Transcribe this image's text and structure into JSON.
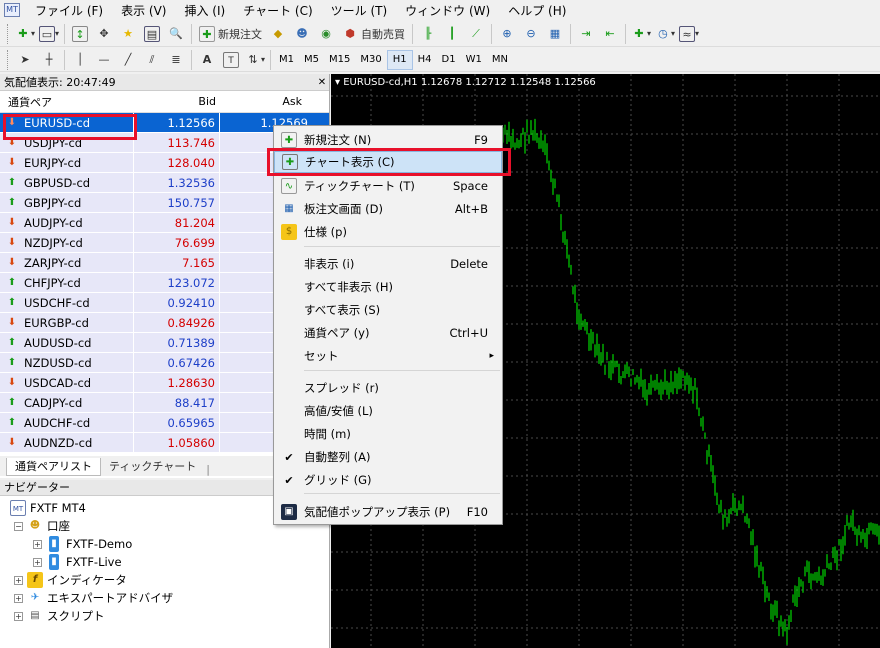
{
  "menubar": {
    "items": [
      "ファイル (F)",
      "表示 (V)",
      "挿入 (I)",
      "チャート (C)",
      "ツール (T)",
      "ウィンドウ (W)",
      "ヘルプ (H)"
    ]
  },
  "toolbar": {
    "new_order_label": "新規注文",
    "auto_trading_label": "自動売買",
    "timeframes": [
      "M1",
      "M5",
      "M15",
      "M30",
      "H1",
      "H4",
      "D1",
      "W1",
      "MN"
    ],
    "active_timeframe": "H1"
  },
  "market_watch": {
    "title": "気配値表示: 20:47:49",
    "columns": [
      "通貨ペア",
      "Bid",
      "Ask"
    ],
    "rows": [
      {
        "symbol": "EURUSD-cd",
        "bid": "1.12566",
        "ask": "1.12569",
        "dir": "dn",
        "selected": true
      },
      {
        "symbol": "USDJPY-cd",
        "bid": "113.746",
        "ask": "11",
        "dir": "dn"
      },
      {
        "symbol": "EURJPY-cd",
        "bid": "128.040",
        "ask": "12",
        "dir": "dn"
      },
      {
        "symbol": "GBPUSD-cd",
        "bid": "1.32536",
        "ask": "1.",
        "dir": "up"
      },
      {
        "symbol": "GBPJPY-cd",
        "bid": "150.757",
        "ask": "15",
        "dir": "up"
      },
      {
        "symbol": "AUDJPY-cd",
        "bid": "81.204",
        "ask": "8",
        "dir": "dn"
      },
      {
        "symbol": "NZDJPY-cd",
        "bid": "76.699",
        "ask": "7",
        "dir": "dn"
      },
      {
        "symbol": "ZARJPY-cd",
        "bid": "7.165",
        "ask": "",
        "dir": "dn"
      },
      {
        "symbol": "CHFJPY-cd",
        "bid": "123.072",
        "ask": "12",
        "dir": "up"
      },
      {
        "symbol": "USDCHF-cd",
        "bid": "0.92410",
        "ask": "0.",
        "dir": "up"
      },
      {
        "symbol": "EURGBP-cd",
        "bid": "0.84926",
        "ask": "0.",
        "dir": "dn"
      },
      {
        "symbol": "AUDUSD-cd",
        "bid": "0.71389",
        "ask": "0.",
        "dir": "up"
      },
      {
        "symbol": "NZDUSD-cd",
        "bid": "0.67426",
        "ask": "0.",
        "dir": "up"
      },
      {
        "symbol": "USDCAD-cd",
        "bid": "1.28630",
        "ask": "1.",
        "dir": "dn"
      },
      {
        "symbol": "CADJPY-cd",
        "bid": "88.417",
        "ask": "8",
        "dir": "up"
      },
      {
        "symbol": "AUDCHF-cd",
        "bid": "0.65965",
        "ask": "0.",
        "dir": "up"
      },
      {
        "symbol": "AUDNZD-cd",
        "bid": "1.05860",
        "ask": "1.",
        "dir": "dn"
      }
    ],
    "tabs": [
      "通貨ペアリスト",
      "ティックチャート"
    ]
  },
  "navigator": {
    "title": "ナビゲーター",
    "root": "FXTF MT4",
    "accounts_label": "口座",
    "accounts": [
      "FXTF-Demo",
      "FXTF-Live"
    ],
    "indicators_label": "インディケータ",
    "experts_label": "エキスパートアドバイザ",
    "scripts_label": "スクリプト"
  },
  "chart": {
    "header": "EURUSD-cd,H1  1.12678 1.12712 1.12548 1.12566",
    "colors": {
      "background": "#000000",
      "bars": "#00ff00",
      "grid": "#4a4a4a"
    }
  },
  "context_menu": {
    "items": [
      {
        "label": "新規注文 (N)",
        "shortcut": "F9",
        "icon": "new-order-icon"
      },
      {
        "label": "チャート表示 (C)",
        "shortcut": "",
        "icon": "chart-window-icon",
        "highlighted": true
      },
      {
        "label": "ティックチャート (T)",
        "shortcut": "Space",
        "icon": "tick-chart-icon"
      },
      {
        "label": "板注文画面 (D)",
        "shortcut": "Alt+B",
        "icon": "depth-of-market-icon"
      },
      {
        "label": "仕様 (p)",
        "shortcut": "",
        "icon": "specification-icon"
      },
      {
        "label": "非表示 (i)",
        "shortcut": "Delete"
      },
      {
        "label": "すべて非表示 (H)",
        "shortcut": ""
      },
      {
        "label": "すべて表示 (S)",
        "shortcut": ""
      },
      {
        "label": "通貨ペア (y)",
        "shortcut": "Ctrl+U"
      },
      {
        "label": "セット",
        "shortcut": "",
        "submenu": true
      },
      {
        "label": "スプレッド (r)",
        "shortcut": ""
      },
      {
        "label": "高値/安値 (L)",
        "shortcut": ""
      },
      {
        "label": "時間 (m)",
        "shortcut": ""
      },
      {
        "label": "自動整列 (A)",
        "shortcut": "",
        "checked": true
      },
      {
        "label": "グリッド (G)",
        "shortcut": "",
        "checked": true
      },
      {
        "label": "気配値ポップアップ表示 (P)",
        "shortcut": "F10",
        "icon": "popup-prices-icon"
      }
    ]
  }
}
